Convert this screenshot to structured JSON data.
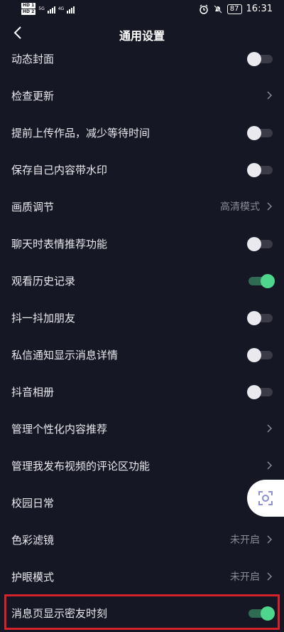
{
  "status_bar": {
    "hd1": "HD 1",
    "hd2": "HD 2",
    "net1": "5G",
    "net2": "4G",
    "battery": "87",
    "time": "16:31"
  },
  "header": {
    "title": "通用设置"
  },
  "settings": [
    {
      "label": "动态封面",
      "control": "toggle",
      "state": "off"
    },
    {
      "label": "检查更新",
      "control": "chevron"
    },
    {
      "label": "提前上传作品，减少等待时间",
      "control": "toggle",
      "state": "off"
    },
    {
      "label": "保存自己内容带水印",
      "control": "toggle",
      "state": "off"
    },
    {
      "label": "画质调节",
      "control": "chevron",
      "value": "高清模式"
    },
    {
      "label": "聊天时表情推荐功能",
      "control": "toggle",
      "state": "off"
    },
    {
      "label": "观看历史记录",
      "control": "toggle",
      "state": "on"
    },
    {
      "label": "抖一抖加朋友",
      "control": "toggle",
      "state": "off"
    },
    {
      "label": "私信通知显示消息详情",
      "control": "toggle",
      "state": "off"
    },
    {
      "label": "抖音相册",
      "control": "toggle",
      "state": "off"
    },
    {
      "label": "管理个性化内容推荐",
      "control": "chevron"
    },
    {
      "label": "管理我发布视频的评论区功能",
      "control": "chevron"
    },
    {
      "label": "校园日常",
      "control": "none"
    },
    {
      "label": "色彩滤镜",
      "control": "chevron",
      "value": "未开启"
    },
    {
      "label": "护眼模式",
      "control": "chevron",
      "value": "未开启"
    },
    {
      "label": "消息页显示密友时刻",
      "control": "toggle",
      "state": "on"
    }
  ],
  "colors": {
    "background": "#161724",
    "toggle_on": "#4fd68d",
    "highlight_border": "#d4232a"
  }
}
